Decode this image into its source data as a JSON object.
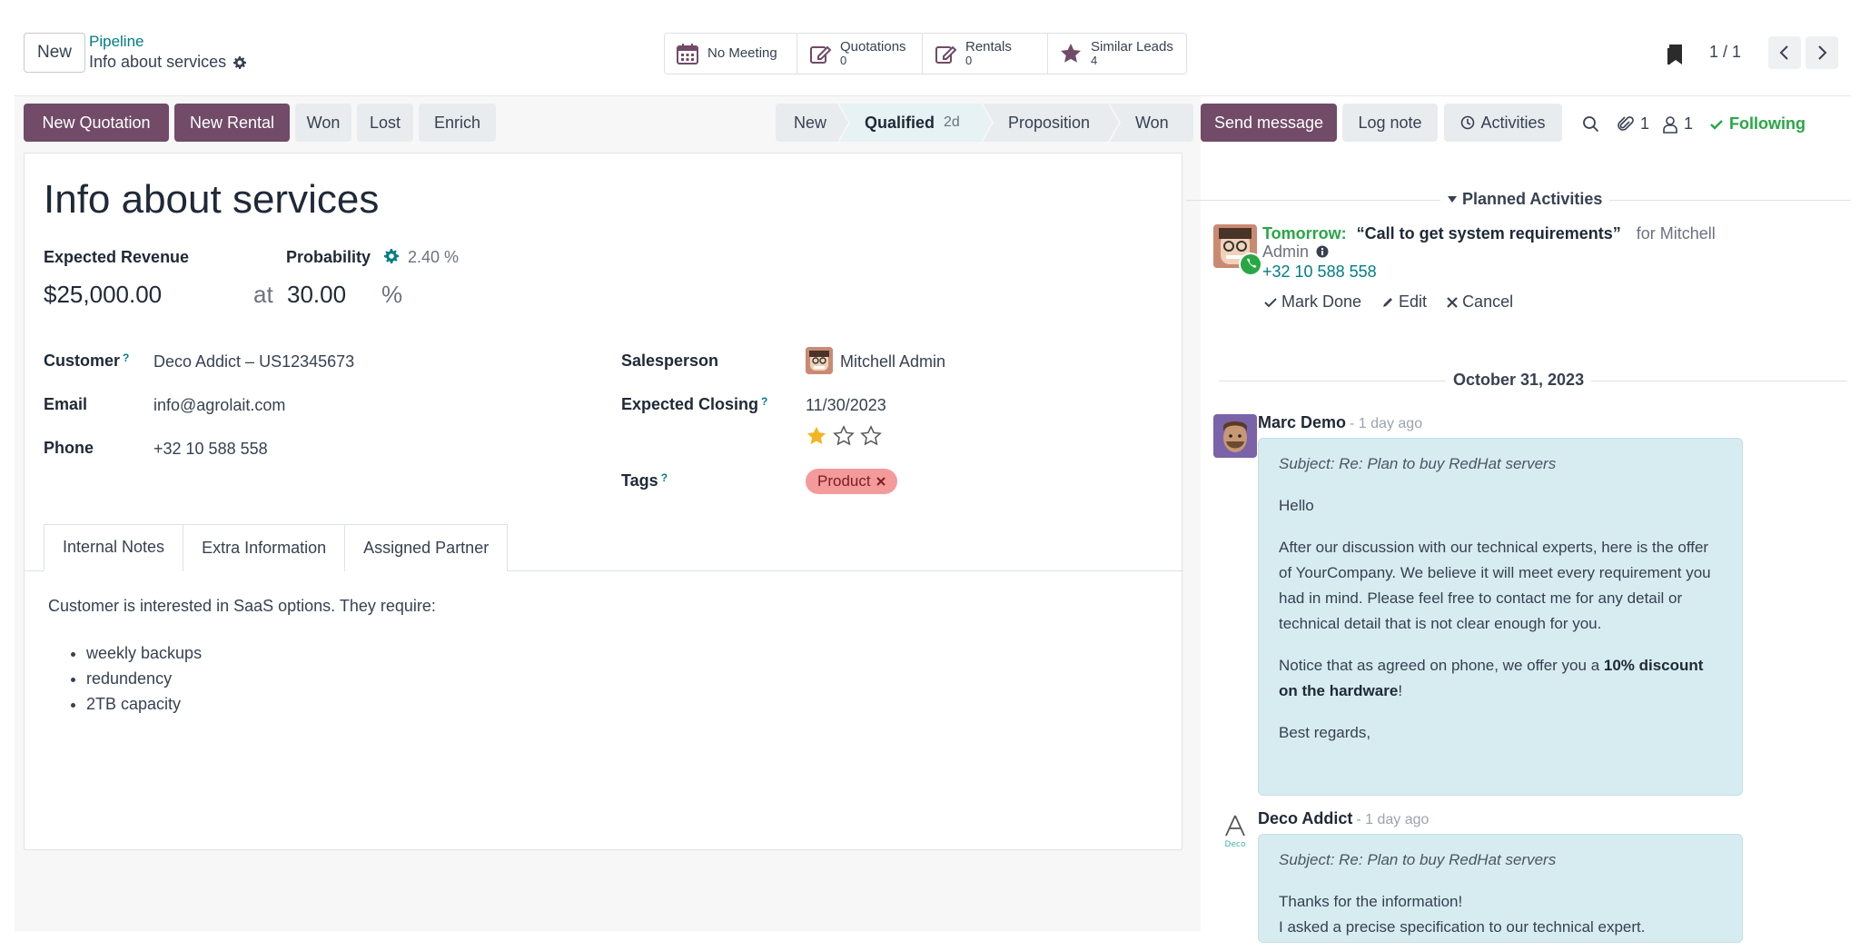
{
  "header": {
    "new_button": "New",
    "breadcrumb_parent": "Pipeline",
    "breadcrumb_current": "Info about services",
    "smart_buttons": [
      {
        "label": "No Meeting",
        "count": "",
        "icon": "calendar-icon"
      },
      {
        "label": "Quotations",
        "count": "0",
        "icon": "edit-icon"
      },
      {
        "label": "Rentals",
        "count": "0",
        "icon": "edit-icon"
      },
      {
        "label": "Similar Leads",
        "count": "4",
        "icon": "star-icon"
      }
    ],
    "pager": "1 / 1"
  },
  "actions": {
    "new_quotation": "New Quotation",
    "new_rental": "New Rental",
    "won": "Won",
    "lost": "Lost",
    "enrich": "Enrich"
  },
  "stages": [
    {
      "label": "New",
      "active": false,
      "days": ""
    },
    {
      "label": "Qualified",
      "active": true,
      "days": "2d"
    },
    {
      "label": "Proposition",
      "active": false,
      "days": ""
    },
    {
      "label": "Won",
      "active": false,
      "days": ""
    }
  ],
  "form": {
    "title": "Info about services",
    "expected_revenue_label": "Expected Revenue",
    "expected_revenue": "$25,000.00",
    "probability_label": "Probability",
    "probability_auto": "2.40 %",
    "at": "at",
    "probability": "30.00",
    "percent": "%",
    "customer_label": "Customer",
    "customer": "Deco Addict – US12345673",
    "email_label": "Email",
    "email": "info@agrolait.com",
    "phone_label": "Phone",
    "phone": "+32 10 588 558",
    "salesperson_label": "Salesperson",
    "salesperson": "Mitchell Admin",
    "closing_label": "Expected Closing",
    "closing": "11/30/2023",
    "priority_stars": 1,
    "tags_label": "Tags",
    "tag": "Product",
    "help_mark": "?",
    "tabs": [
      "Internal Notes",
      "Extra Information",
      "Assigned Partner"
    ],
    "notes_intro": "Customer is interested in SaaS options. They require:",
    "notes_items": [
      "weekly backups",
      "redundency",
      "2TB capacity"
    ]
  },
  "chatter": {
    "send_message": "Send message",
    "log_note": "Log note",
    "activities": "Activities",
    "attachments": "1",
    "followers": "1",
    "following": "Following",
    "planned_activities": "Planned Activities",
    "activity": {
      "when": "Tomorrow:",
      "summary": "“Call to get system requirements”",
      "for": "for Mitchell",
      "for2": "Admin",
      "phone": "+32 10 588 558",
      "mark_done": "Mark Done",
      "edit": "Edit",
      "cancel": "Cancel"
    },
    "date_separator": "October 31, 2023",
    "messages": [
      {
        "author": "Marc Demo",
        "ago": "- 1 day ago",
        "subject": "Subject: Re: Plan to buy RedHat servers",
        "p1": "Hello",
        "p2": "After our discussion with our technical experts, here is the offer of YourCompany. We believe it will meet every requirement you had in mind. Please feel free to contact me for any detail or technical detail that is not clear enough for you.",
        "p3_pre": "Notice that as agreed on phone, we offer you a ",
        "p3_bold": "10% discount on the hardware",
        "p3_post": "!",
        "p4": "Best regards,"
      },
      {
        "author": "Deco Addict",
        "ago": "- 1 day ago",
        "subject": "Subject: Re: Plan to buy RedHat servers",
        "p1": "Thanks for the information!",
        "p2": "I asked a precise specification to our technical expert."
      }
    ]
  },
  "colors": {
    "brand": "#714b67",
    "teal": "#017e84",
    "success": "#28a745",
    "bubble": "#d7ecf0",
    "tag": "#f49a9a"
  }
}
